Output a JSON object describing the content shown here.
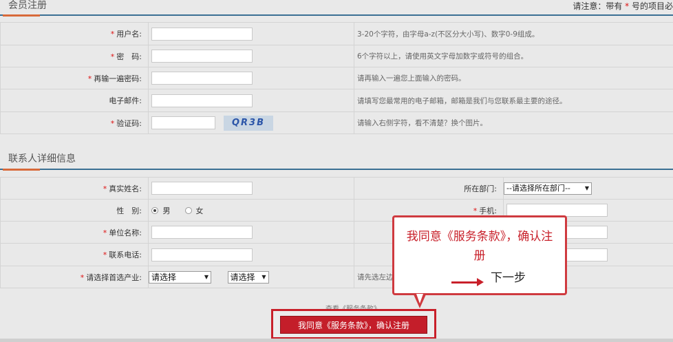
{
  "register": {
    "title": "会员注册",
    "note_prefix": "请注意：带有",
    "note_star": "*",
    "note_suffix": "号的项目必",
    "fields": [
      {
        "label": "用户名:",
        "required": "*",
        "hint": "3-20个字符，由字母a-z(不区分大小写)、数字0-9组成。"
      },
      {
        "label": "密　码:",
        "required": "*",
        "hint": "6个字符以上，请使用英文字母加数字或符号的组合。"
      },
      {
        "label": "再输一遍密码:",
        "required": "*",
        "hint": "请再输入一遍您上面输入的密码。"
      },
      {
        "label": "电子邮件:",
        "required": "",
        "hint": "请填写您最常用的电子邮箱，邮箱是我们与您联系最主要的途径。"
      },
      {
        "label": "验证码:",
        "required": "*",
        "hint": "请输入右侧字符，看不清楚？换个图片。"
      }
    ],
    "captcha": "QR3B"
  },
  "contact": {
    "title": "联系人详细信息",
    "name_label": "真实姓名:",
    "dept_label": "所在部门:",
    "dept_select": "--请选择所在部门--",
    "gender_label": "性　别:",
    "gender_male": "男",
    "gender_female": "女",
    "mobile_label": "手机:",
    "company_label": "单位名称:",
    "phone_label": "联系电话:",
    "industry_label": "请选择首选产业:",
    "industry_select_1": "请选择",
    "industry_select_2": "请选择",
    "industry_hint": "请先选左边的产业，再选右边的子类",
    "star": "*"
  },
  "terms_link": "查看《服务条款》",
  "submit_label": "我同意《服务条款》，确认注册",
  "callout": {
    "text": "我同意《服务条款》，确认注册",
    "next_label": "下一步"
  },
  "colors": {
    "accent_red": "#c41e2a",
    "section_line": "#3a6f93",
    "required_star": "#dd1111"
  }
}
